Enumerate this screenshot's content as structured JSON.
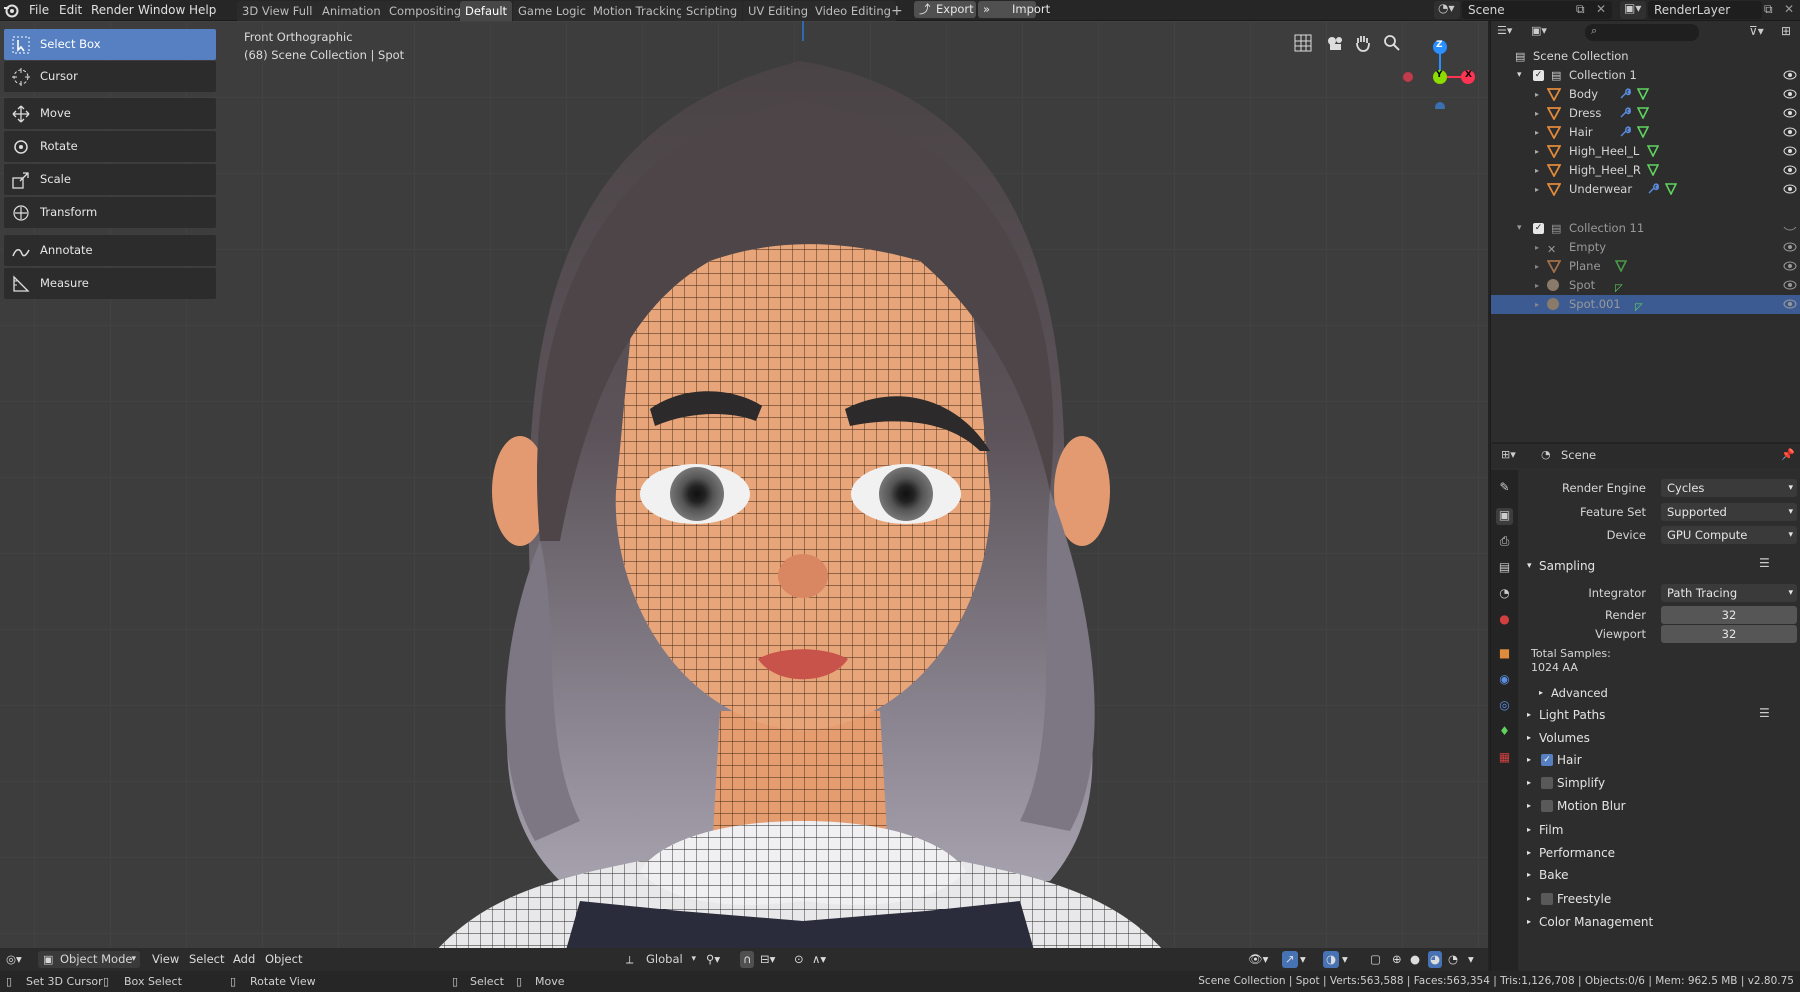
{
  "menu": [
    "File",
    "Edit",
    "Render",
    "Window",
    "Help"
  ],
  "workspaces": [
    "3D View Full",
    "Animation",
    "Compositing",
    "Default",
    "Game Logic",
    "Motion Tracking",
    "Scripting",
    "UV Editing",
    "Video Editing"
  ],
  "active_workspace": "Default",
  "add_tab": "+",
  "export_label": "Export",
  "import_label": "Import",
  "scene_name": "Scene",
  "render_layer": "RenderLayer",
  "tools": [
    "Select Box",
    "Cursor",
    "Move",
    "Rotate",
    "Scale",
    "Transform",
    "Annotate",
    "Measure"
  ],
  "viewport": {
    "view_name": "Front Orthographic",
    "collection_info": "(68) Scene Collection | Spot"
  },
  "gizmo": {
    "z": "Z",
    "y": "Y",
    "x": "X"
  },
  "outliner": {
    "root": "Scene Collection",
    "collection1": "Collection 1",
    "collection1_items": [
      "Body",
      "Dress",
      "Hair",
      "High_Heel_L",
      "High_Heel_R",
      "Underwear"
    ],
    "collection11": "Collection 11",
    "collection11_items": [
      "Empty",
      "Plane",
      "Spot",
      "Spot.001"
    ],
    "selected": "Spot.001"
  },
  "properties": {
    "context": "Scene",
    "render_engine_label": "Render Engine",
    "render_engine": "Cycles",
    "feature_set_label": "Feature Set",
    "feature_set": "Supported",
    "device_label": "Device",
    "device": "GPU Compute",
    "sampling": "Sampling",
    "integrator_label": "Integrator",
    "integrator": "Path Tracing",
    "render_label": "Render",
    "render_samples": "32",
    "viewport_label": "Viewport",
    "viewport_samples": "32",
    "total_samples_label": "Total Samples:",
    "total_samples": "1024 AA",
    "advanced": "Advanced",
    "panels": [
      "Light Paths",
      "Volumes",
      "Hair",
      "Simplify",
      "Motion Blur",
      "Film",
      "Performance",
      "Bake",
      "Freestyle",
      "Color Management"
    ]
  },
  "footer": {
    "mode": "Object Mode",
    "view": "View",
    "select": "Select",
    "add": "Add",
    "object": "Object",
    "orientation": "Global"
  },
  "status": {
    "set_cursor": "Set 3D Cursor",
    "box_select": "Box Select",
    "rotate_view": "Rotate View",
    "select": "Select",
    "move": "Move",
    "stats": "Scene Collection | Spot | Verts:563,588 | Faces:563,354 | Tris:1,126,708 | Objects:0/6 | Mem: 962.5 MB | v2.80.75"
  },
  "colors": {
    "accent": "#5680c2",
    "axis_x": "#ff3352",
    "axis_y": "#8bdc00",
    "axis_z": "#2890ff",
    "mesh_orange": "#e08a3c",
    "mesh_green": "#5fd35f"
  }
}
